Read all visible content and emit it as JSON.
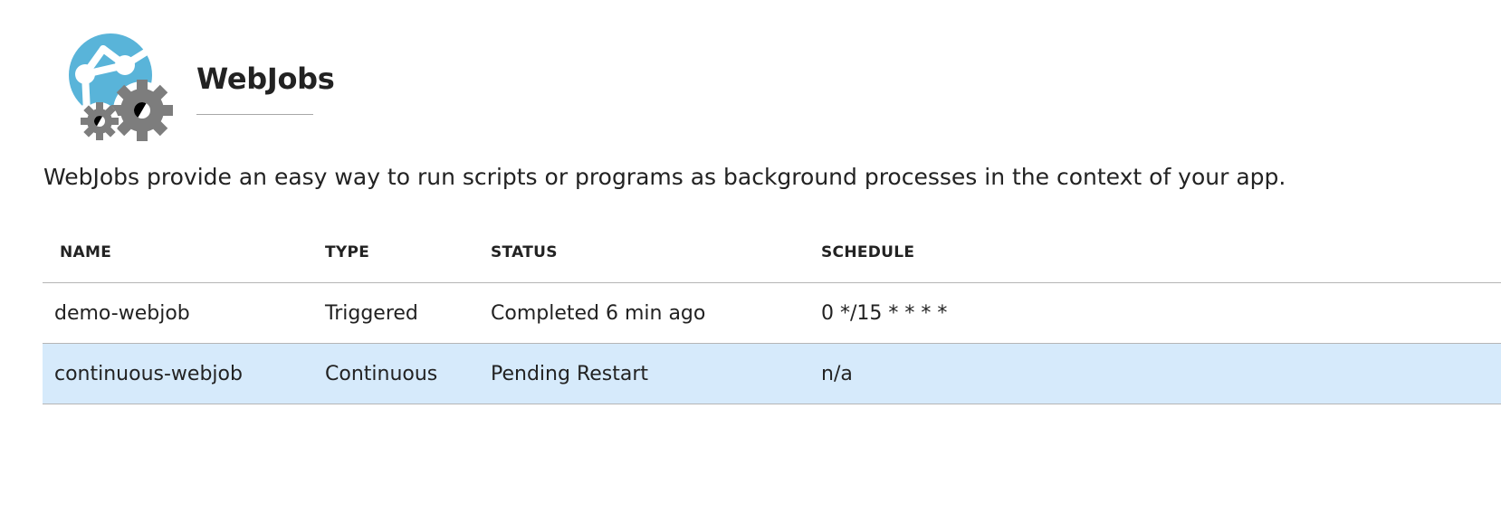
{
  "header": {
    "title": "WebJobs",
    "logo_icon": "webjobs-globe-gears-icon"
  },
  "description": "WebJobs provide an easy way to run scripts or programs as background processes in the context of your app.",
  "table": {
    "columns": [
      "NAME",
      "TYPE",
      "STATUS",
      "SCHEDULE"
    ],
    "rows": [
      {
        "name": "demo-webjob",
        "type": "Triggered",
        "status": "Completed 6 min ago",
        "schedule": "0 */15 * * * *",
        "selected": false
      },
      {
        "name": "continuous-webjob",
        "type": "Continuous",
        "status": "Pending Restart",
        "schedule": "n/a",
        "selected": true
      }
    ]
  },
  "colors": {
    "globe": "#59b4d9",
    "gear": "#7a7a7a",
    "selected_row": "#d6eafb",
    "divider": "#b5b5b5"
  }
}
